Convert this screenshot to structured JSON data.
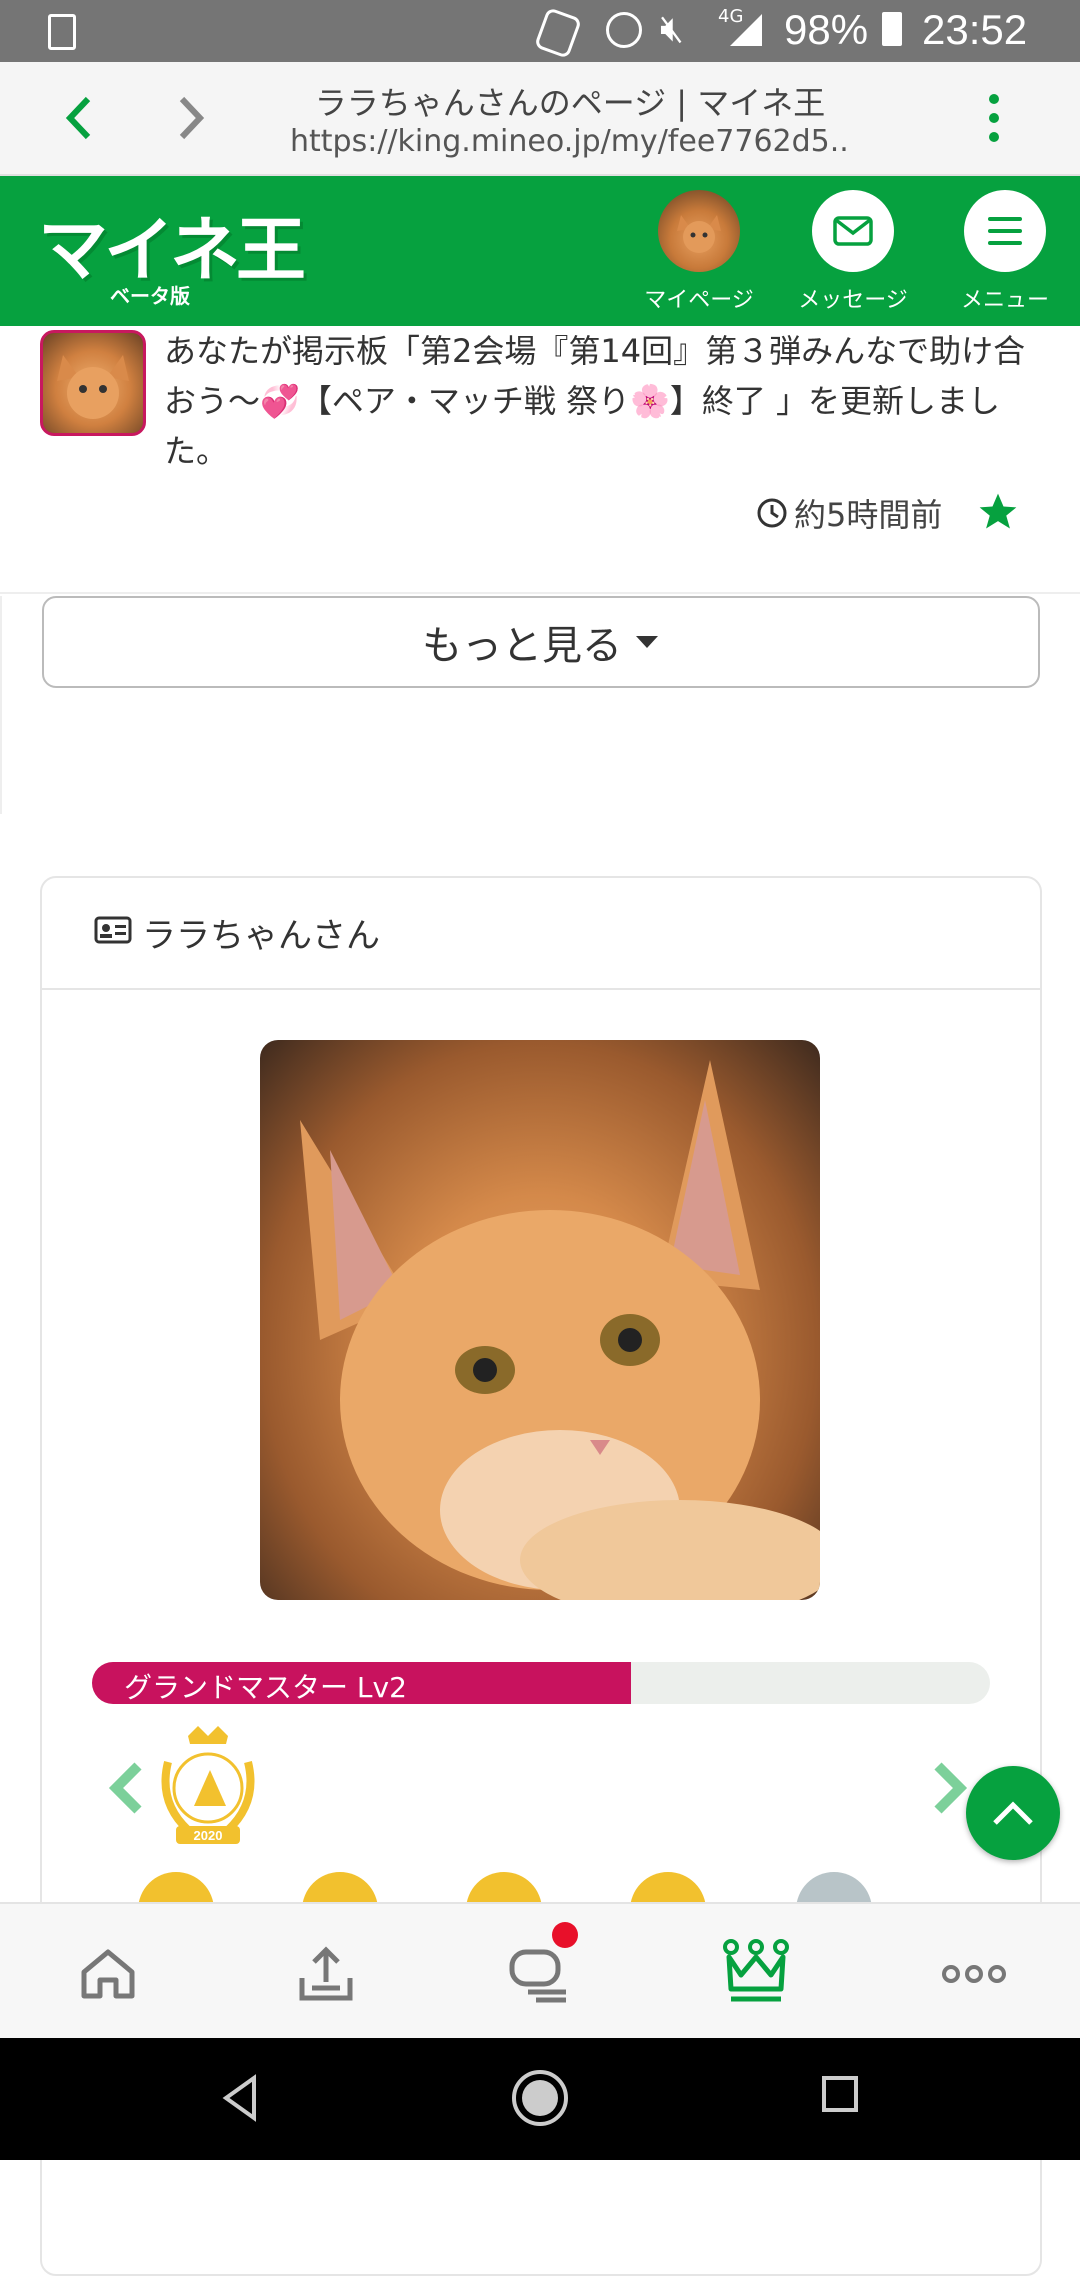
{
  "status_bar": {
    "battery": "98%",
    "time": "23:52",
    "network": "4G"
  },
  "browser": {
    "page_title": "ララちゃんさんのページ | マイネ王",
    "url": "https://king.mineo.jp/my/fee7762d5..."
  },
  "header": {
    "logo": "マイネ王",
    "beta_label": "ベータ版",
    "mypage_label": "マイページ",
    "message_label": "メッセージ",
    "menu_label": "メニュー"
  },
  "activity": {
    "text": "あなたが掲示板「第2会場『第14回』第３弾みんなで助け合おう～💞【ペア・マッチ戦 祭り🌸】終了 」を更新しました。",
    "time": "約5時間前"
  },
  "more_button": {
    "label": "もっと見る"
  },
  "profile": {
    "name": "ララちゃんさん",
    "rank_label": "グランドマスター Lv2",
    "rank_progress": 0.6,
    "badge_year": "2020"
  },
  "colors": {
    "brand_green": "#06a13f",
    "rank_pink": "#c8125e"
  }
}
